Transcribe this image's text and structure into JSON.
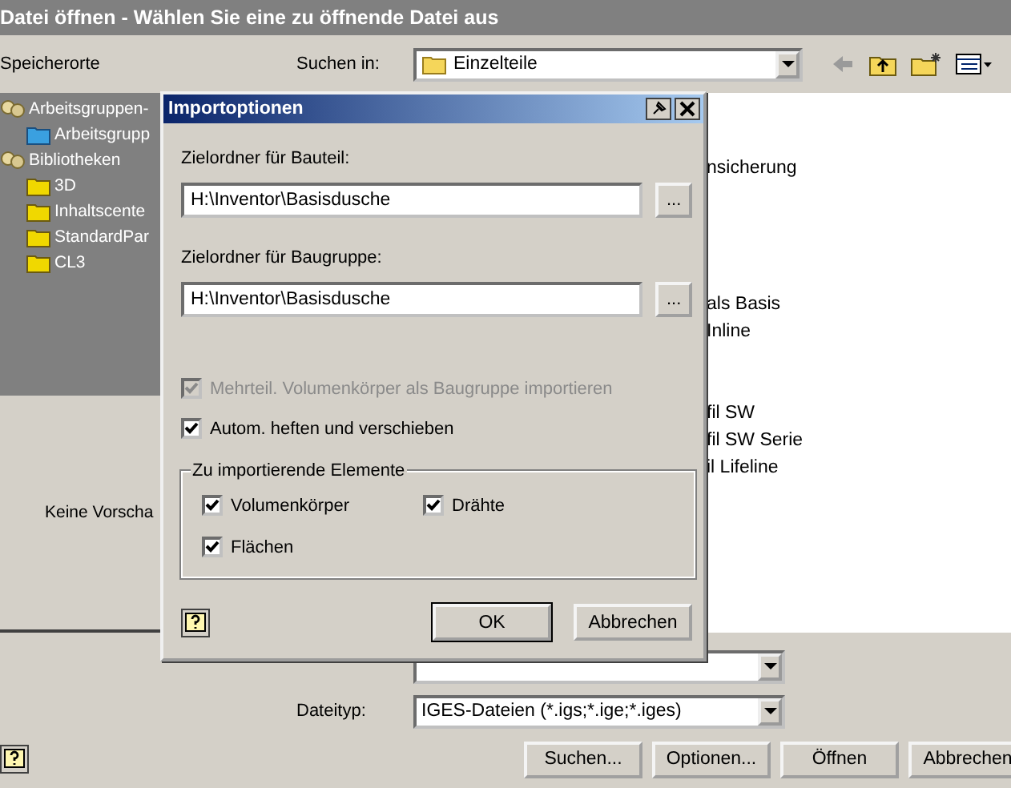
{
  "window": {
    "title": "Datei öffnen - Wählen Sie eine zu öffnende Datei aus"
  },
  "places_label": "Speicherorte",
  "look_in": {
    "label": "Suchen in:",
    "value": "Einzelteile"
  },
  "places_tree": [
    {
      "label": "Arbeitsgruppen-",
      "kind": "group",
      "children": [
        {
          "label": "Arbeitsgrupp",
          "kind": "project"
        }
      ]
    },
    {
      "label": "Bibliotheken",
      "kind": "group",
      "children": [
        {
          "label": "3D",
          "kind": "folder"
        },
        {
          "label": "Inhaltscente",
          "kind": "folder"
        },
        {
          "label": "StandardPar",
          "kind": "folder"
        },
        {
          "label": "CL3",
          "kind": "folder"
        }
      ]
    }
  ],
  "preview": {
    "text": "Keine Vorscha"
  },
  "file_list": [
    "nsicherung",
    "als Basis",
    "Inline",
    "fil SW",
    "fil SW Serie",
    "il Lifeline"
  ],
  "file_type": {
    "label": "Dateityp:",
    "value": "IGES-Dateien (*.igs;*.ige;*.iges)"
  },
  "buttons": [
    {
      "label": "Suchen..."
    },
    {
      "label": "Optionen..."
    },
    {
      "label": "Öffnen"
    },
    {
      "label": "Abbrechen"
    }
  ],
  "dialog": {
    "title": "Importoptionen",
    "fields": [
      {
        "label": "Zielordner für Bauteil:",
        "value": "H:\\Inventor\\Basisdusche",
        "browse": "..."
      },
      {
        "label": "Zielordner für Baugruppe:",
        "value": "H:\\Inventor\\Basisdusche",
        "browse": "..."
      }
    ],
    "options": [
      {
        "label": "Mehrteil. Volumenkörper als Baugruppe importieren",
        "checked": true,
        "disabled": true
      },
      {
        "label": "Autom. heften und verschieben",
        "checked": true,
        "disabled": false
      }
    ],
    "group": {
      "title": "Zu importierende Elemente",
      "items": [
        {
          "label": "Volumenkörper",
          "checked": true
        },
        {
          "label": "Drähte",
          "checked": true
        },
        {
          "label": "Flächen",
          "checked": true
        }
      ]
    },
    "buttons": [
      {
        "label": "OK",
        "default": true
      },
      {
        "label": "Abbrechen",
        "default": false
      }
    ]
  }
}
